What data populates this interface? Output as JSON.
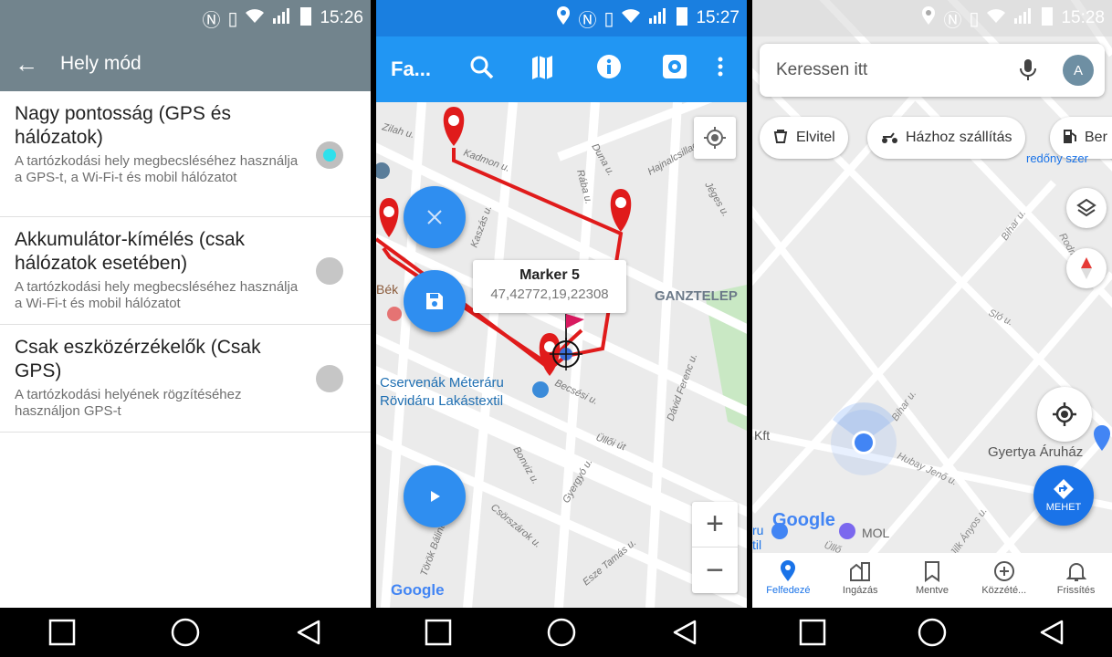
{
  "panel1": {
    "status_time": "15:26",
    "title": "Hely mód",
    "options": [
      {
        "title": "Nagy pontosság (GPS és hálózatok)",
        "desc": "A tartózkodási hely megbecsléséhez használja a GPS-t, a Wi-Fi-t és mobil hálózatot",
        "selected": true
      },
      {
        "title": "Akkumulátor-kímélés (csak hálózatok esetében)",
        "desc": "A tartózkodási hely megbecsléséhez használja a Wi-Fi-t és mobil hálózatot",
        "selected": false
      },
      {
        "title": "Csak eszközérzékelők (Csak GPS)",
        "desc": "A tartózkodási helyének rögzítéséhez használjon GPS-t",
        "selected": false
      }
    ]
  },
  "panel2": {
    "status_time": "15:27",
    "title": "Fa...",
    "marker_popup": {
      "title": "Marker 5",
      "coords": "47,42772,19,22308"
    },
    "map_labels": {
      "ganztelep": "GANZTELEP",
      "cservenak1": "Cservenák Méteráru",
      "cservenak2": "Rövidáru Lakástextil",
      "bek": "Bék",
      "google": "Google",
      "kadmon": "Kadmon u.",
      "duna": "Duna u.",
      "raba": "Rába u.",
      "jeges": "Jéges u.",
      "hajnalcsillag": "Hajnalcsillag u.",
      "kaszas": "Kaszás u.",
      "ullo": "Üllői út",
      "david": "Dávid Ferenc u.",
      "bonviz": "Bonviz u.",
      "gyergyo": "Gyergyó u.",
      "csorszarok": "Csörszárok u.",
      "torok": "Török Bálint u.",
      "esze": "Esze Tamás u.",
      "becsesi": "Becsési u.",
      "zilah": "Zilah u."
    },
    "zoom_in": "+",
    "zoom_out": "−"
  },
  "panel3": {
    "status_time": "15:28",
    "search_placeholder": "Keressen itt",
    "avatar_letter": "A",
    "chips": [
      "Elvitel",
      "Házhoz szállítás",
      "Ber"
    ],
    "chip_sub": "redőny szer",
    "go_label": "MEHET",
    "map_labels": {
      "kft": "Kft",
      "gyertya": "Gyertya Áruház",
      "mol": "MOL",
      "google": "Google",
      "ru": "ru",
      "til": "til",
      "bihar1": "Bihar u.",
      "bihar2": "Bihar u.",
      "hubay": "Hubay Jenő u.",
      "slo": "Sló u.",
      "rodmo": "Rodmo",
      "uller": "Üllő",
      "anyos": "Jilk Ányos u."
    },
    "bottom_nav": [
      "Felfedezé",
      "Ingázás",
      "Mentve",
      "Közzété...",
      "Frissítés"
    ]
  },
  "colors": {
    "settings_bar": "#72848d",
    "app_blue": "#2196f3",
    "route_red": "#e01b1b",
    "maps_blue": "#1a73e8"
  }
}
